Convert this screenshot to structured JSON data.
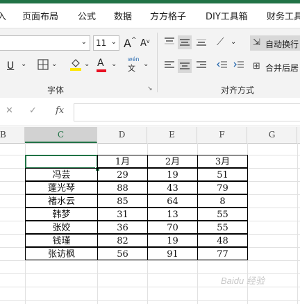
{
  "ribbon": {
    "tabs": [
      "入",
      "页面布局",
      "公式",
      "数据",
      "方方格子",
      "DIY工具箱",
      "财务工具"
    ],
    "font_size": "11",
    "grow_font": "A",
    "shrink_font": "A",
    "wen_label": "wén",
    "wen_char": "文",
    "wrap_text_label": "自动换行",
    "merge_center_label": "合并后居",
    "font_group_label": "字体",
    "align_group_label": "对齐方式",
    "underline_glyph": "U",
    "font_color_glyph": "A"
  },
  "formula_bar": {
    "cancel_glyph": "✕",
    "confirm_glyph": "✓",
    "fx_label": "fx",
    "cell_content": ""
  },
  "columns": [
    "B",
    "C",
    "D",
    "E",
    "F",
    "G"
  ],
  "table": {
    "header": [
      "",
      "1月",
      "2月",
      "3月"
    ],
    "rows": [
      [
        "冯芸",
        "29",
        "19",
        "51"
      ],
      [
        "蓬光琴",
        "88",
        "43",
        "79"
      ],
      [
        "褚水云",
        "85",
        "64",
        "8"
      ],
      [
        "韩梦",
        "31",
        "13",
        "55"
      ],
      [
        "张姣",
        "36",
        "70",
        "55"
      ],
      [
        "钱瑾",
        "82",
        "19",
        "48"
      ],
      [
        "张访枫",
        "56",
        "91",
        "77"
      ]
    ]
  },
  "watermark": "Baidu 经验",
  "colors": {
    "accent": "#217346",
    "fill_marker": "#ffe600",
    "font_color_marker": "#e81123"
  }
}
